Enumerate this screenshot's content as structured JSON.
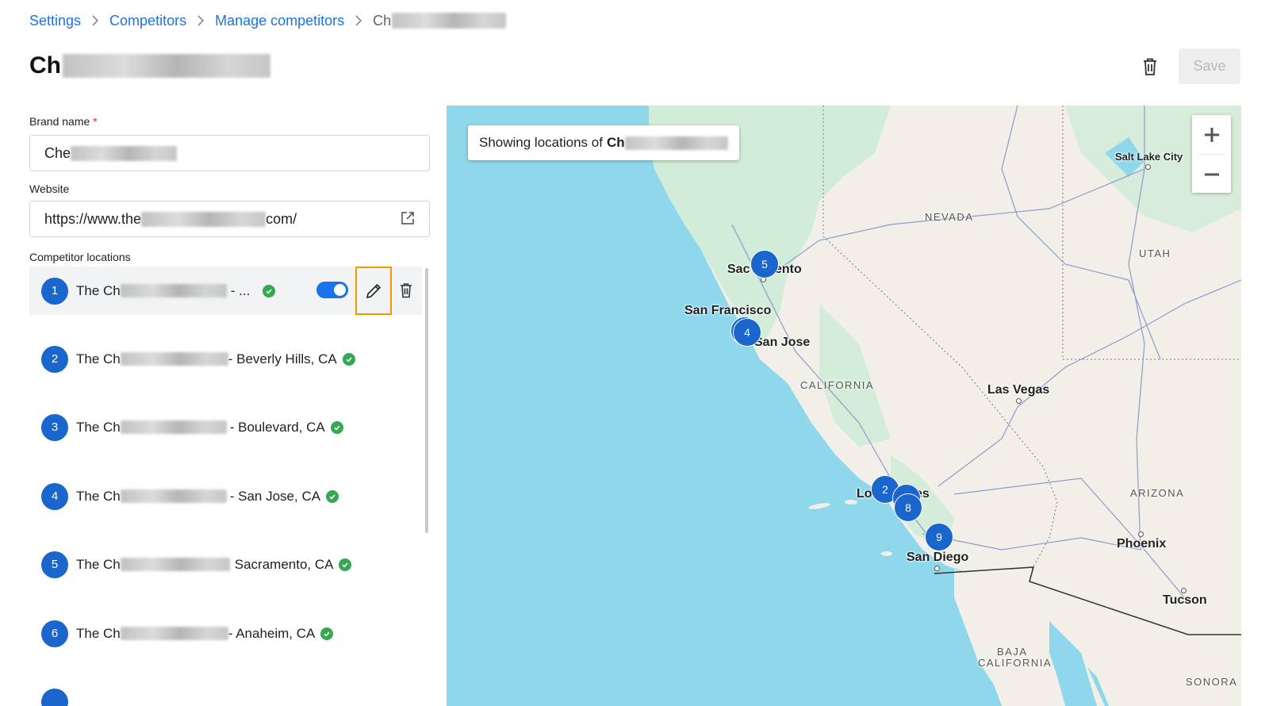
{
  "breadcrumb": {
    "items": [
      "Settings",
      "Competitors",
      "Manage competitors"
    ],
    "current_visible": "Ch"
  },
  "page": {
    "title_visible": "Ch",
    "save_label": "Save"
  },
  "form": {
    "brand_name_label": "Brand name",
    "required_marker": "*",
    "brand_name_value_visible": "Che",
    "website_label": "Website",
    "website_prefix": "https://www.the",
    "website_suffix": "com/",
    "locations_label": "Competitor locations"
  },
  "locations": [
    {
      "number": "1",
      "prefix": "The Ch",
      "suffix": "- ...",
      "verified": true,
      "enabled": true,
      "selected": true
    },
    {
      "number": "2",
      "prefix": "The Ch",
      "suffix": "- Beverly Hills, CA",
      "verified": true
    },
    {
      "number": "3",
      "prefix": "The Ch",
      "suffix": "- Boulevard, CA",
      "verified": true
    },
    {
      "number": "4",
      "prefix": "The Ch",
      "suffix": "- San Jose, CA",
      "verified": true
    },
    {
      "number": "5",
      "prefix": "The Ch",
      "suffix": "Sacramento, CA",
      "verified": true
    },
    {
      "number": "6",
      "prefix": "The Ch",
      "suffix": "- Anaheim, CA",
      "verified": true
    }
  ],
  "map": {
    "banner_prefix": "Showing locations of",
    "banner_name_visible": "Ch",
    "zoom_in": "+",
    "zoom_out": "−",
    "labels": {
      "salt_lake_city": "Salt Lake City",
      "nevada": "NEVADA",
      "utah": "UTAH",
      "sacramento_left": "Sac",
      "sacramento_right": "ento",
      "san_francisco": "San Francisco",
      "san_jose": "San Jose",
      "california": "CALIFORNIA",
      "las_vegas": "Las Vegas",
      "arizona": "ARIZONA",
      "los_angeles_left": "Lo",
      "los_angeles_right": "es",
      "phoenix": "Phoenix",
      "san_diego": "San Diego",
      "tucson": "Tucson",
      "baja_california_1": "BAJA",
      "baja_california_2": "CALIFORNIA",
      "sonora": "SONORA"
    },
    "markers": [
      "5",
      "4",
      "2",
      "7",
      "8",
      "9"
    ]
  },
  "colors": {
    "accent": "#1a73e8",
    "marker": "#1a66cc",
    "verified": "#34a853",
    "highlight_border": "#f29900",
    "water": "#8fd7eb",
    "land": "#f1efe8",
    "vegetation": "#cdebd6"
  }
}
